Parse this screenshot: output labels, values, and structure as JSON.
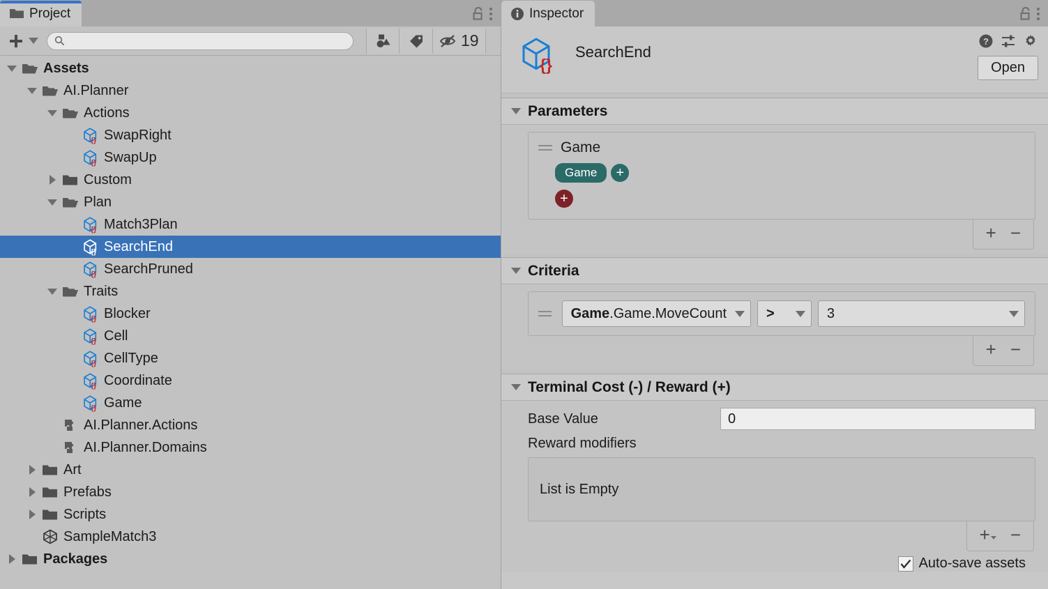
{
  "project_panel": {
    "tab": {
      "label": "Project",
      "icon": "folder-icon"
    },
    "lock_icon": "unlock-icon",
    "menu_icon": "kebab-menu-icon",
    "toolbar": {
      "create_label": "+",
      "create_caret": "chevron-down-icon",
      "search_placeholder": "",
      "search_value": "",
      "search_icon": "search-icon",
      "type_filter_icon": "shapes-filter-icon",
      "label_filter_icon": "tag-icon",
      "hidden_icon": "eye-slash-icon",
      "hidden_count": "19"
    },
    "tree": [
      {
        "label": "Assets",
        "indent": 0,
        "twisty": "down",
        "icon": "folder-open-icon",
        "bold": true,
        "selected": false
      },
      {
        "label": "AI.Planner",
        "indent": 1,
        "twisty": "down",
        "icon": "folder-open-icon",
        "bold": false,
        "selected": false
      },
      {
        "label": "Actions",
        "indent": 2,
        "twisty": "down",
        "icon": "folder-open-icon",
        "bold": false,
        "selected": false
      },
      {
        "label": "SwapRight",
        "indent": 3,
        "twisty": "none",
        "icon": "asset-cube-icon",
        "bold": false,
        "selected": false
      },
      {
        "label": "SwapUp",
        "indent": 3,
        "twisty": "none",
        "icon": "asset-cube-icon",
        "bold": false,
        "selected": false
      },
      {
        "label": "Custom",
        "indent": 2,
        "twisty": "right",
        "icon": "folder-icon",
        "bold": false,
        "selected": false
      },
      {
        "label": "Plan",
        "indent": 2,
        "twisty": "down",
        "icon": "folder-open-icon",
        "bold": false,
        "selected": false
      },
      {
        "label": "Match3Plan",
        "indent": 3,
        "twisty": "none",
        "icon": "asset-cube-icon",
        "bold": false,
        "selected": false
      },
      {
        "label": "SearchEnd",
        "indent": 3,
        "twisty": "none",
        "icon": "asset-cube-icon",
        "bold": false,
        "selected": true
      },
      {
        "label": "SearchPruned",
        "indent": 3,
        "twisty": "none",
        "icon": "asset-cube-icon",
        "bold": false,
        "selected": false
      },
      {
        "label": "Traits",
        "indent": 2,
        "twisty": "down",
        "icon": "folder-open-icon",
        "bold": false,
        "selected": false
      },
      {
        "label": "Blocker",
        "indent": 3,
        "twisty": "none",
        "icon": "asset-cube-icon",
        "bold": false,
        "selected": false
      },
      {
        "label": "Cell",
        "indent": 3,
        "twisty": "none",
        "icon": "asset-cube-icon",
        "bold": false,
        "selected": false
      },
      {
        "label": "CellType",
        "indent": 3,
        "twisty": "none",
        "icon": "asset-cube-icon",
        "bold": false,
        "selected": false
      },
      {
        "label": "Coordinate",
        "indent": 3,
        "twisty": "none",
        "icon": "asset-cube-icon",
        "bold": false,
        "selected": false
      },
      {
        "label": "Game",
        "indent": 3,
        "twisty": "none",
        "icon": "asset-cube-icon",
        "bold": false,
        "selected": false
      },
      {
        "label": "AI.Planner.Actions",
        "indent": 2,
        "twisty": "none",
        "icon": "assembly-icon",
        "bold": false,
        "selected": false
      },
      {
        "label": "AI.Planner.Domains",
        "indent": 2,
        "twisty": "none",
        "icon": "assembly-icon",
        "bold": false,
        "selected": false
      },
      {
        "label": "Art",
        "indent": 1,
        "twisty": "right",
        "icon": "folder-icon",
        "bold": false,
        "selected": false
      },
      {
        "label": "Prefabs",
        "indent": 1,
        "twisty": "right",
        "icon": "folder-icon",
        "bold": false,
        "selected": false
      },
      {
        "label": "Scripts",
        "indent": 1,
        "twisty": "right",
        "icon": "folder-icon",
        "bold": false,
        "selected": false
      },
      {
        "label": "SampleMatch3",
        "indent": 1,
        "twisty": "none",
        "icon": "unity-scene-icon",
        "bold": false,
        "selected": false
      },
      {
        "label": "Packages",
        "indent": 0,
        "twisty": "right",
        "icon": "folder-icon",
        "bold": true,
        "selected": false
      }
    ]
  },
  "inspector_panel": {
    "tab": {
      "label": "Inspector",
      "icon": "info-icon"
    },
    "lock_icon": "unlock-icon",
    "menu_icon": "kebab-menu-icon",
    "object_name": "SearchEnd",
    "object_icon": "asset-cube-icon",
    "help_icon": "help-icon",
    "preset_icon": "preset-sliders-icon",
    "settings_icon": "gear-icon",
    "open_button": "Open",
    "parameters": {
      "title": "Parameters",
      "twisty": "chevron-down-icon",
      "entries": [
        {
          "name": "Game",
          "drag_handle": "drag-handle-icon",
          "traits": [
            {
              "label": "Game",
              "color": "#2a6b68"
            }
          ],
          "add_trait_label": "+",
          "add_exclude_label": "+"
        }
      ],
      "add_label": "+",
      "remove_label": "−"
    },
    "criteria": {
      "title": "Criteria",
      "twisty": "chevron-down-icon",
      "rows": [
        {
          "drag_handle": "drag-handle-icon",
          "field_bold": "Game",
          "field_rest": ".Game.MoveCount",
          "operator": ">",
          "value": "3"
        }
      ],
      "add_label": "+",
      "remove_label": "−"
    },
    "terminal": {
      "title": "Terminal Cost (-) / Reward (+)",
      "twisty": "chevron-down-icon",
      "base_value_label": "Base Value",
      "base_value": "0",
      "reward_modifiers_label": "Reward modifiers",
      "empty_text": "List is Empty",
      "add_label": "+",
      "remove_label": "−"
    },
    "autosave": {
      "label": "Auto-save assets",
      "checked": true,
      "check_icon": "check-icon"
    }
  },
  "colors": {
    "selection_blue": "#3a72b8",
    "tab_accent": "#3874c8",
    "trait_teal": "#2a6b68",
    "exclude_red": "#7d2228",
    "panel_bg": "#c8c8c8",
    "tree_bg": "#c2c2c2"
  }
}
